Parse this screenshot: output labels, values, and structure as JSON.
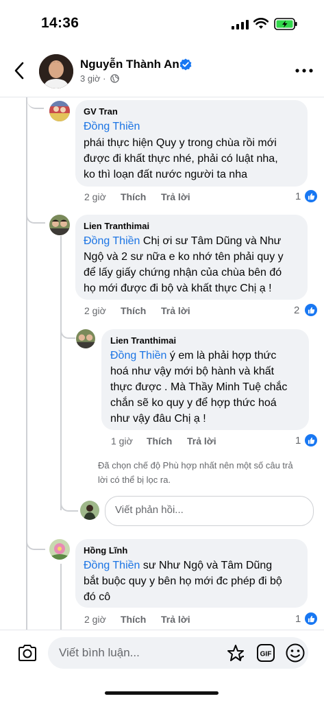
{
  "status_bar": {
    "time": "14:36"
  },
  "header": {
    "author": "Nguyễn Thành An",
    "post_time": "3 giờ ·"
  },
  "comments": [
    {
      "name": "GV Tran",
      "mention": "Đồng Thiền",
      "lines": [
        "phái thực hiện Quy y trong chùa rồi mới",
        "được đi khất thực nhé,  phải có luật nha,",
        "ko thì loạn đất nước người ta nha"
      ],
      "time": "2 giờ",
      "like": "Thích",
      "reply": "Trả lời",
      "likes": "1"
    },
    {
      "name": "Lien Tranthimai",
      "mention": "Đồng Thiền",
      "first_line_rest": " Chị ơi sư Tâm Dũng và Như",
      "lines": [
        "Ngộ và 2 sư nữa e ko nhớ tên phải quy y",
        "để lấy giấy chứng nhận của chùa bên đó",
        "họ mới được đi bộ và khất thực Chị ạ !"
      ],
      "time": "2 giờ",
      "like": "Thích",
      "reply": "Trả lời",
      "likes": "2"
    },
    {
      "name": "Lien Tranthimai",
      "mention": "Đồng Thiền",
      "first_line_rest": " ý em là phải hợp thức",
      "lines": [
        "hoá như vậy mới bộ hành và khất",
        "thực được . Mà Thầy Minh Tuệ chắc",
        "chắn sẽ ko quy y để hợp thức hoá",
        "như vậy đâu Chị ạ !"
      ],
      "time": "1 giờ",
      "like": "Thích",
      "reply": "Trả lời",
      "likes": "1"
    },
    {
      "name": "Hồng Lĩnh",
      "mention": "Đồng Thiền",
      "first_line_rest": " sư Như Ngộ và Tâm Dũng",
      "lines": [
        "bắt buộc quy y bên họ mới đc phép đi bộ",
        "đó cô"
      ],
      "time": "2 giờ",
      "like": "Thích",
      "reply": "Trả lời",
      "likes": "1"
    }
  ],
  "filter_notice": [
    "Đã chọn chế độ Phù hợp nhất nên một số câu trả",
    "lời có thể bị lọc ra."
  ],
  "reply_placeholder": "Viết phản hồi...",
  "comment_placeholder": "Viết bình luận...",
  "icons": {
    "back": "chevron-left-icon",
    "more": "more-dots-icon",
    "verified": "verified-badge-icon",
    "audience": "globe-icon",
    "camera": "camera-icon",
    "sticker": "sticker-icon",
    "gif": "gif-icon",
    "emoji": "emoji-icon",
    "like": "like-thumb-icon"
  },
  "colors": {
    "accent": "#1877f2",
    "mention": "#1b74e4",
    "bubble": "#f0f2f5",
    "meta": "#65676b"
  }
}
